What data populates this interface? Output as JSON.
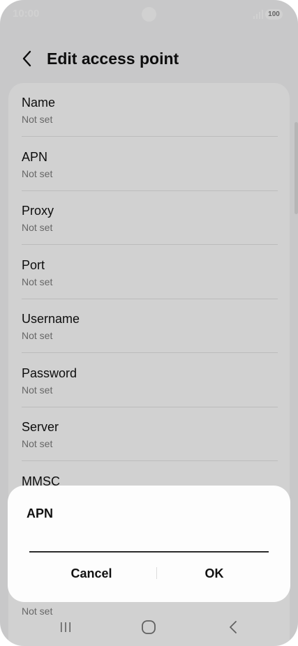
{
  "status_bar": {
    "time": "10:00",
    "battery": "100"
  },
  "header": {
    "title": "Edit access point",
    "back_icon": "chevron-left-icon"
  },
  "fields": [
    {
      "label": "Name",
      "value": "Not set"
    },
    {
      "label": "APN",
      "value": "Not set"
    },
    {
      "label": "Proxy",
      "value": "Not set"
    },
    {
      "label": "Port",
      "value": "Not set"
    },
    {
      "label": "Username",
      "value": "Not set"
    },
    {
      "label": "Password",
      "value": "Not set"
    },
    {
      "label": "Server",
      "value": "Not set"
    },
    {
      "label": "MMSC",
      "value": ""
    },
    {
      "label": "",
      "value": "Not set"
    }
  ],
  "dialog": {
    "title": "APN",
    "input_value": "",
    "cancel_label": "Cancel",
    "ok_label": "OK"
  },
  "nav": {
    "recents_icon": "recents-icon",
    "home_icon": "home-icon",
    "back_icon": "back-icon"
  }
}
